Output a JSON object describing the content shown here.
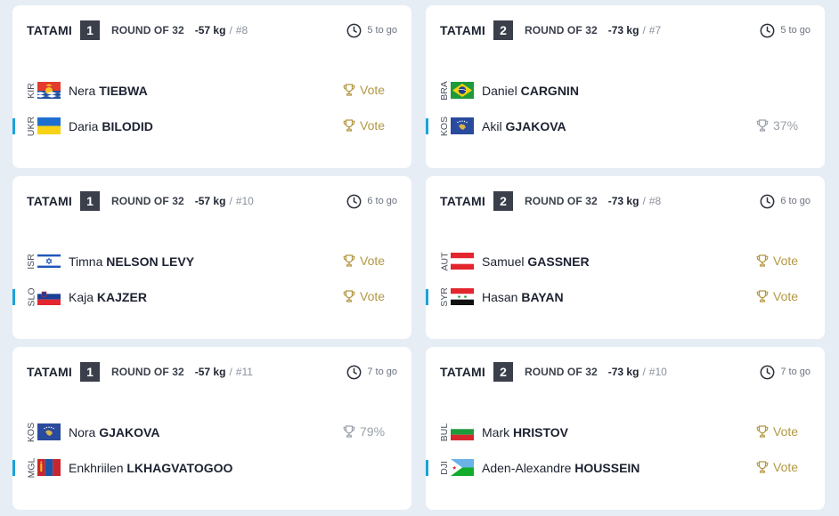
{
  "colors": {
    "accent_bar": "#1aa3d8",
    "vote_gold": "#b39844",
    "percent_gray": "#9aa0aa",
    "badge_dark": "#3a3f4b"
  },
  "cards": [
    {
      "tatami_label": "TATAMI",
      "tatami_num": "1",
      "round": "ROUND OF 32",
      "weight": "-57 kg",
      "sep": "/",
      "match": "#8",
      "togo": "5 to go",
      "f1": {
        "nat": "KIR",
        "first": "Nera",
        "last": "TIEBWA",
        "action": "Vote",
        "icon": "trophy-icon"
      },
      "f2": {
        "nat": "UKR",
        "first": "Daria",
        "last": "BILODID",
        "action": "Vote",
        "icon": "trophy-icon"
      }
    },
    {
      "tatami_label": "TATAMI",
      "tatami_num": "2",
      "round": "ROUND OF 32",
      "weight": "-73 kg",
      "sep": "/",
      "match": "#7",
      "togo": "5 to go",
      "f1": {
        "nat": "BRA",
        "first": "Daniel",
        "last": "CARGNIN",
        "action": "",
        "icon": ""
      },
      "f2": {
        "nat": "KOS",
        "first": "Akil",
        "last": "GJAKOVA",
        "action": "37%",
        "icon": "trophy-icon"
      }
    },
    {
      "tatami_label": "TATAMI",
      "tatami_num": "1",
      "round": "ROUND OF 32",
      "weight": "-57 kg",
      "sep": "/",
      "match": "#10",
      "togo": "6 to go",
      "f1": {
        "nat": "ISR",
        "first": "Timna",
        "last": "NELSON LEVY",
        "action": "Vote",
        "icon": "trophy-icon"
      },
      "f2": {
        "nat": "SLO",
        "first": "Kaja",
        "last": "KAJZER",
        "action": "Vote",
        "icon": "trophy-icon"
      }
    },
    {
      "tatami_label": "TATAMI",
      "tatami_num": "2",
      "round": "ROUND OF 32",
      "weight": "-73 kg",
      "sep": "/",
      "match": "#8",
      "togo": "6 to go",
      "f1": {
        "nat": "AUT",
        "first": "Samuel",
        "last": "GASSNER",
        "action": "Vote",
        "icon": "trophy-icon"
      },
      "f2": {
        "nat": "SYR",
        "first": "Hasan",
        "last": "BAYAN",
        "action": "Vote",
        "icon": "trophy-icon"
      }
    },
    {
      "tatami_label": "TATAMI",
      "tatami_num": "1",
      "round": "ROUND OF 32",
      "weight": "-57 kg",
      "sep": "/",
      "match": "#11",
      "togo": "7 to go",
      "f1": {
        "nat": "KOS",
        "first": "Nora",
        "last": "GJAKOVA",
        "action": "79%",
        "icon": "trophy-icon"
      },
      "f2": {
        "nat": "MGL",
        "first": "Enkhriilen",
        "last": "LKHAGVATOGOO",
        "action": "",
        "icon": ""
      }
    },
    {
      "tatami_label": "TATAMI",
      "tatami_num": "2",
      "round": "ROUND OF 32",
      "weight": "-73 kg",
      "sep": "/",
      "match": "#10",
      "togo": "7 to go",
      "f1": {
        "nat": "BUL",
        "first": "Mark",
        "last": "HRISTOV",
        "action": "Vote",
        "icon": "trophy-icon"
      },
      "f2": {
        "nat": "DJI",
        "first": "Aden-Alexandre",
        "last": "HOUSSEIN",
        "action": "Vote",
        "icon": "trophy-icon"
      }
    }
  ]
}
